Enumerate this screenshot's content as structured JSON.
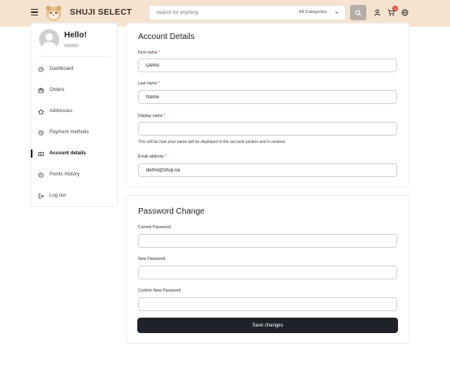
{
  "header": {
    "brand": "SHUJI SELECT",
    "search_placeholder": "Search for anything",
    "category_label": "All Categories",
    "cart_count": "3"
  },
  "sidebar": {
    "greeting": "Hello!",
    "items": [
      {
        "label": "Dashboard",
        "icon": "dashboard-icon"
      },
      {
        "label": "Orders",
        "icon": "orders-icon"
      },
      {
        "label": "Addresses",
        "icon": "addresses-icon"
      },
      {
        "label": "Payment methods",
        "icon": "payment-icon"
      },
      {
        "label": "Account details",
        "icon": "account-details-icon",
        "active": true
      },
      {
        "label": "Points History",
        "icon": "points-icon"
      },
      {
        "label": "Log out",
        "icon": "logout-icon"
      }
    ]
  },
  "account_details": {
    "title": "Account Details",
    "first_name_label": "First name",
    "first_name_value": "Demo",
    "last_name_label": "Last name",
    "last_name_value": "Name",
    "display_name_label": "Display name",
    "display_name_value": "",
    "display_name_hint": "This will be how your name will be displayed in the account section and in reviews",
    "email_label": "Email address",
    "email_value": "demo@shuji.ca",
    "required_mark": "*"
  },
  "password_change": {
    "title": "Password Change",
    "current_label": "Current Password",
    "new_label": "New Password",
    "confirm_label": "Confirm New Password",
    "save_label": "Save changes"
  },
  "colors": {
    "header_bg": "#f6e3cf",
    "search_button": "#b6aca8",
    "badge": "#e2443b",
    "save_button": "#1f2228"
  }
}
